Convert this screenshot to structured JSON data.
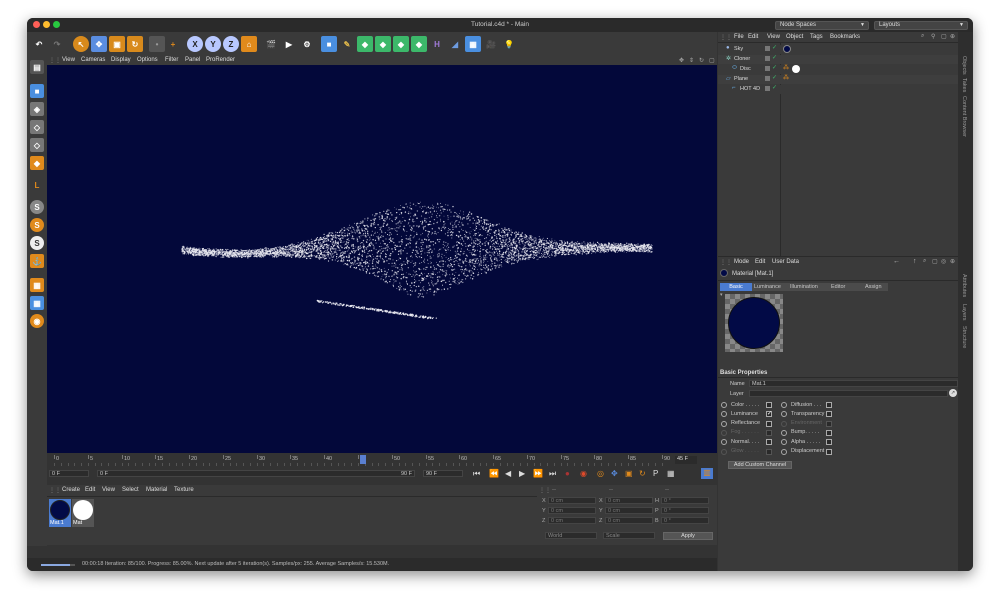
{
  "window": {
    "title": "Tutorial.c4d * - Main",
    "node_spaces": "Node Spaces",
    "layouts": "Layouts"
  },
  "viewport_menu": [
    "View",
    "Cameras",
    "Display",
    "Options",
    "Filter",
    "Panel",
    "ProRender"
  ],
  "toolbar": {
    "axis_x": "X",
    "axis_y": "Y",
    "axis_z": "Z"
  },
  "left_toolbar": {
    "s1": "S",
    "s2": "S",
    "s3": "S"
  },
  "timeline": {
    "ticks": [
      "0",
      "5",
      "10",
      "15",
      "20",
      "25",
      "30",
      "35",
      "40",
      "45",
      "50",
      "55",
      "60",
      "65",
      "70",
      "75",
      "80",
      "85",
      "90"
    ],
    "current_frame": "45 F",
    "start": "0 F",
    "min": "0 F",
    "max": "90 F",
    "end": "90 F"
  },
  "material_manager": {
    "menu": [
      "Create",
      "Edit",
      "View",
      "Select",
      "Material",
      "Texture"
    ],
    "materials": [
      {
        "name": "Mat.1",
        "color": "#020a46"
      },
      {
        "name": "Mat",
        "color": "#ffffff"
      }
    ]
  },
  "coords": {
    "headers": [
      "--",
      "--",
      "--"
    ],
    "rows": [
      {
        "a": "X",
        "av": "0 cm",
        "b": "X",
        "bv": "0 cm",
        "c": "H",
        "cv": "0 °"
      },
      {
        "a": "Y",
        "av": "0 cm",
        "b": "Y",
        "bv": "0 cm",
        "c": "P",
        "cv": "0 °"
      },
      {
        "a": "Z",
        "av": "0 cm",
        "b": "Z",
        "bv": "0 cm",
        "c": "B",
        "cv": "0 °"
      }
    ],
    "world": "World",
    "scale": "Scale",
    "apply": "Apply"
  },
  "status": "00:00:18 Iteration: 85/100. Progress: 85.00%. Next update after 5 iteration(s). Samples/px: 255. Average Samples/s: 15.530M.",
  "progress": 0.85,
  "object_manager": {
    "menu": [
      "File",
      "Edit",
      "View",
      "Object",
      "Tags",
      "Bookmarks"
    ],
    "objects": [
      {
        "name": "Sky",
        "indent": 0
      },
      {
        "name": "Cloner",
        "indent": 0
      },
      {
        "name": "Disc",
        "indent": 1
      },
      {
        "name": "Plane",
        "indent": 0
      },
      {
        "name": "HOT 4D",
        "indent": 1
      }
    ]
  },
  "attributes": {
    "menu": [
      "Mode",
      "Edit",
      "User Data"
    ],
    "material_title": "Material [Mat.1]",
    "tabs": [
      "Basic",
      "Luminance",
      "Illumination",
      "Editor",
      "Assign"
    ],
    "section": "Basic Properties",
    "name_label": "Name",
    "name_value": "Mat.1",
    "layer_label": "Layer",
    "channels_left": [
      {
        "label": "Color . . . . .",
        "checked": false
      },
      {
        "label": "Luminance",
        "checked": true
      },
      {
        "label": "Reflectance",
        "checked": false
      },
      {
        "label": "Fog . . . . . .",
        "checked": false
      },
      {
        "label": "Normal. . . .",
        "checked": false
      },
      {
        "label": "Glow . . . . .",
        "checked": false
      }
    ],
    "channels_right": [
      {
        "label": "Diffusion . . .",
        "checked": false
      },
      {
        "label": "Transparency",
        "checked": false
      },
      {
        "label": "Environment",
        "checked": false
      },
      {
        "label": "Bump. . . . .",
        "checked": false
      },
      {
        "label": "Alpha . . . . .",
        "checked": false
      },
      {
        "label": "Displacement",
        "checked": false
      }
    ],
    "add_channel": "Add Custom Channel"
  },
  "side_tabs": [
    "Objects",
    "Takes",
    "Content Browser",
    "Attributes",
    "Layers",
    "Structure"
  ],
  "colors": {
    "viewport_bg": "#03083a",
    "accent": "#4a7bd0",
    "orange": "#e08a1c"
  }
}
